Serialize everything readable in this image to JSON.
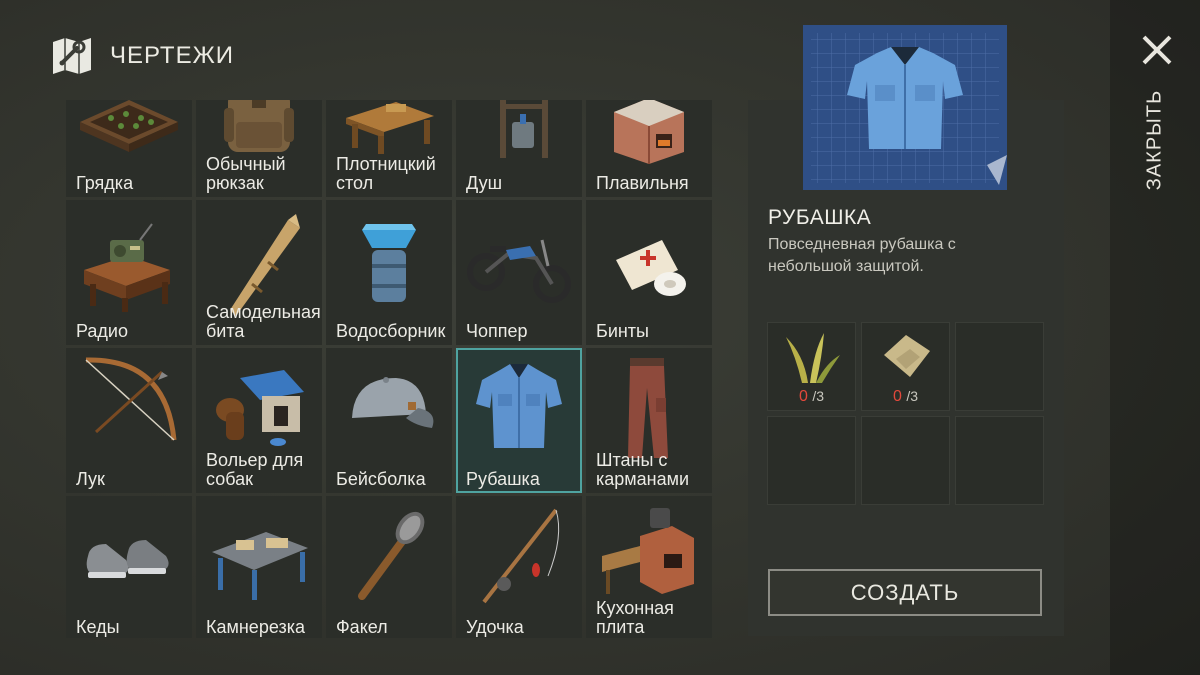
{
  "header": {
    "title": "ЧЕРТЕЖИ",
    "icon": "blueprint-map-icon"
  },
  "blueprints": [
    {
      "label": "Грядка",
      "icon": "garden-bed-icon"
    },
    {
      "label": "Обычный рюкзак",
      "icon": "backpack-icon"
    },
    {
      "label": "Плотницкий стол",
      "icon": "carpentry-table-icon"
    },
    {
      "label": "Душ",
      "icon": "shower-icon"
    },
    {
      "label": "Плавильня",
      "icon": "furnace-icon"
    },
    {
      "label": "Радио",
      "icon": "radio-icon"
    },
    {
      "label": "Самодельная бита",
      "icon": "bat-icon"
    },
    {
      "label": "Водосборник",
      "icon": "water-collector-icon"
    },
    {
      "label": "Чоппер",
      "icon": "motorcycle-icon"
    },
    {
      "label": "Бинты",
      "icon": "bandage-icon"
    },
    {
      "label": "Лук",
      "icon": "bow-icon"
    },
    {
      "label": "Вольер для собак",
      "icon": "dog-kennel-icon"
    },
    {
      "label": "Бейсболка",
      "icon": "cap-icon"
    },
    {
      "label": "Рубашка",
      "icon": "shirt-icon",
      "selected": true
    },
    {
      "label": "Штаны с карманами",
      "icon": "pants-icon"
    },
    {
      "label": "Кеды",
      "icon": "sneakers-icon"
    },
    {
      "label": "Камнерезка",
      "icon": "stone-cutter-icon"
    },
    {
      "label": "Факел",
      "icon": "torch-icon"
    },
    {
      "label": "Удочка",
      "icon": "fishing-rod-icon"
    },
    {
      "label": "Кухонная плита",
      "icon": "kitchen-stove-icon"
    }
  ],
  "detail": {
    "title": "РУБАШКА",
    "description": "Повседневная рубашка с небольшой защитой.",
    "ingredients": [
      {
        "icon": "plant-fiber-icon",
        "have": "0",
        "need": "/3"
      },
      {
        "icon": "cloth-icon",
        "have": "0",
        "need": "/3"
      }
    ],
    "create_label": "СОЗДАТЬ"
  },
  "close": {
    "label": "ЗАКРЫТЬ"
  },
  "colors": {
    "selected_border": "#4fa3a0",
    "missing_count": "#e2483b",
    "blueprint_blue": "#2f4f86"
  }
}
